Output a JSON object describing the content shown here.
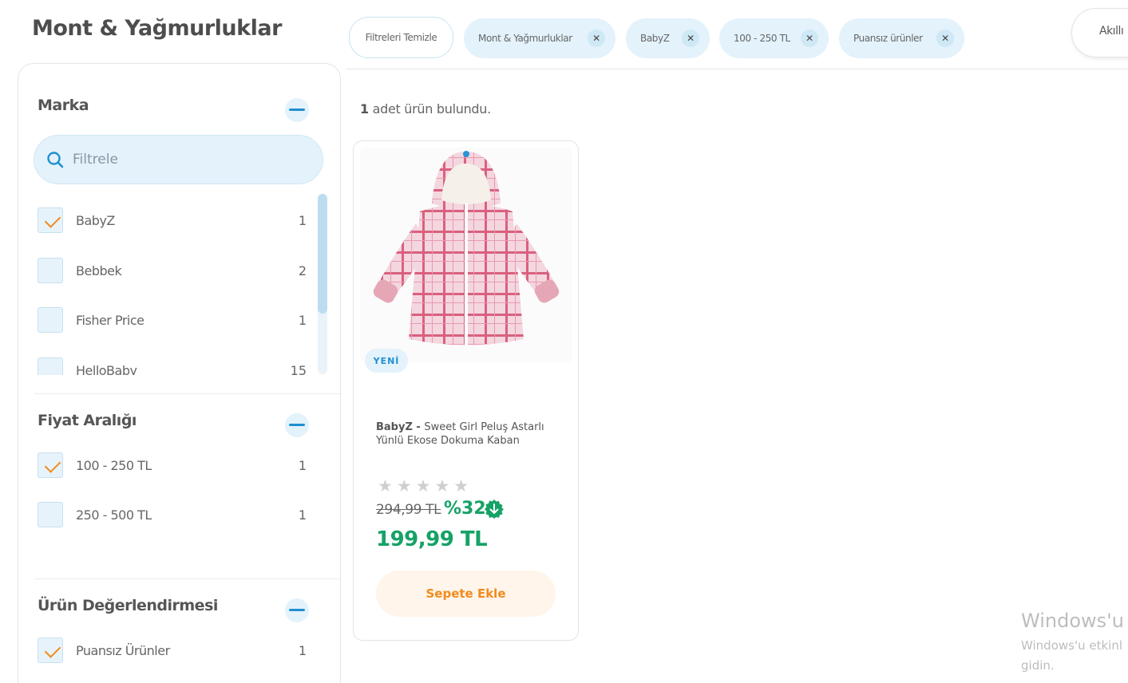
{
  "page": {
    "title": "Mont & Yağmurluklar"
  },
  "active_filters": {
    "clear_label": "Filtreleri Temizle",
    "chips": [
      "Mont & Yağmurluklar",
      "BabyZ",
      "100 - 250 TL",
      "Puansız ürünler"
    ],
    "remove_glyph": "✕"
  },
  "sort": {
    "label": "Akıllı"
  },
  "sidebar": {
    "brand": {
      "title": "Marka",
      "filter_placeholder": "Filtrele",
      "items": [
        {
          "label": "BabyZ",
          "count": "1",
          "checked": true
        },
        {
          "label": "Bebbek",
          "count": "2",
          "checked": false
        },
        {
          "label": "Fisher Price",
          "count": "1",
          "checked": false
        },
        {
          "label": "HelloBaby",
          "count": "15",
          "checked": false
        }
      ]
    },
    "price": {
      "title": "Fiyat Aralığı",
      "items": [
        {
          "label": "100 - 250 TL",
          "count": "1",
          "checked": true
        },
        {
          "label": "250 - 500 TL",
          "count": "1",
          "checked": false
        }
      ]
    },
    "rating": {
      "title": "Ürün Değerlendirmesi",
      "items": [
        {
          "label": "Puansız Ürünler",
          "count": "1",
          "checked": true
        }
      ]
    }
  },
  "results": {
    "count_number": "1",
    "count_text": " adet ürün bulundu."
  },
  "product": {
    "badge": "YENİ",
    "brand": "BabyZ - ",
    "name": "Sweet Girl Peluş Astarlı Yünlü Ekose Dokuma Kaban",
    "stars": "★★★★★",
    "rating_filled": 0,
    "old_price": "294,99 TL",
    "discount": "%32",
    "price": "199,99 TL",
    "add_to_cart": "Sepete Ekle"
  },
  "os_watermark": {
    "title": "Windows'u E",
    "line1": "Windows'u etkinl",
    "line2": "gidin."
  },
  "colors": {
    "accent_blue": "#1f8fd0",
    "accent_orange": "#f28b1d",
    "price_green": "#16a266",
    "chip_bg": "#e3f2fb"
  }
}
